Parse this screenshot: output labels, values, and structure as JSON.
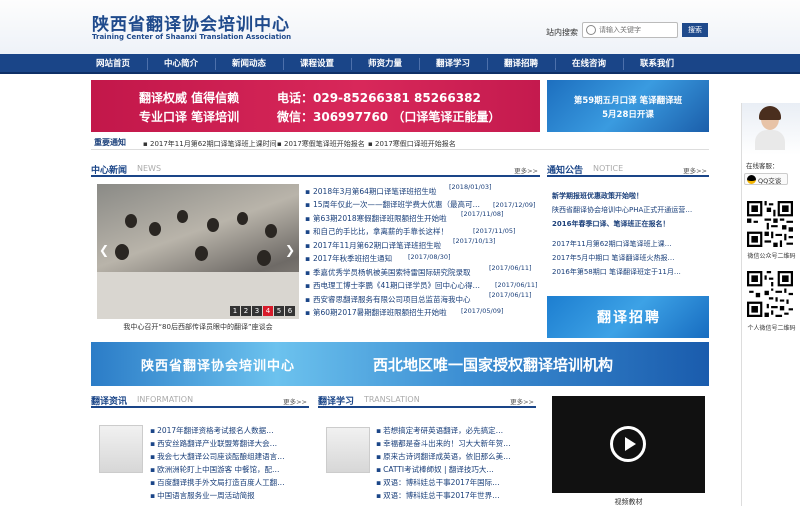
{
  "header": {
    "logo_cn": "陕西省翻译协会培训中心",
    "logo_en": "Training Center of  Shaanxi Translation Association",
    "search_label": "站内搜索",
    "search_placeholder": "请输入关键字",
    "search_button": "搜索"
  },
  "nav": [
    "网站首页",
    "中心简介",
    "新闻动态",
    "课程设置",
    "师资力量",
    "翻译学习",
    "翻译招聘",
    "在线咨询",
    "联系我们"
  ],
  "banner_main": {
    "line1": "翻译权威  值得信赖",
    "line2": "专业口译  笔译培训",
    "phone": "电话：029-85266381 85266382",
    "wechat": "微信：306997760 （口译笔译正能量）"
  },
  "banner_side": {
    "line1": "第59期五月口译 笔译翻译班",
    "line2": "5月28日开课"
  },
  "important_notice": {
    "label": "重要通知",
    "items": [
      "2017年11月第62期口译笔译班上课时间",
      "2017寒假笔译班开始报名",
      "2017寒假口译班开始报名"
    ]
  },
  "center_news": {
    "title_cn": "中心新闻",
    "title_en": "NEWS",
    "more": "更多>>",
    "caption": "我中心召开“80后西部传译员眼中的翻译”座谈会",
    "slides": [
      "1",
      "2",
      "3",
      "4",
      "5",
      "6"
    ],
    "active_slide": 4,
    "items": [
      {
        "text": "2018年3月第64期口译笔译班招生啦",
        "date": "[2018/01/03]"
      },
      {
        "text": "15周年仅此一次——翻译班学费大优惠（最高可…",
        "date": "[2017/12/09]"
      },
      {
        "text": "第63期2018寒假翻译班限额招生开始啦",
        "date": "[2017/11/08]"
      },
      {
        "text": "和自己的手比比，拿离薪的手靠长这样！",
        "date": "[2017/11/05]"
      },
      {
        "text": "2017年11月第62期口译笔译班招生啦",
        "date": "[2017/10/13]"
      },
      {
        "text": "2017年秋季班招生通知",
        "date": "[2017/08/30]"
      },
      {
        "text": "季嘉优秀学员杨帆被美国索特雷国际研究院录取",
        "date": "[2017/06/11]"
      },
      {
        "text": "西电理工博士李鹏《41期口译学员》回中心心得…",
        "date": "[2017/06/11]"
      },
      {
        "text": "西安睿思翻译服务有限公司项目总监苗海我中心",
        "date": "[2017/06/11]"
      },
      {
        "text": "第60期2017暑期翻译班限额招生开始啦",
        "date": "[2017/05/09]"
      }
    ]
  },
  "announcements": {
    "title_cn": "通知公告",
    "title_en": "NOTICE",
    "more": "更多>>",
    "items": [
      {
        "text": "新学期报班优惠政策开始啦！",
        "highlight": true
      },
      {
        "text": "陕西省翻译协会培训中心PHA正式开通运营…",
        "highlight": false
      },
      {
        "text": "2016年春季口译、笔译班正在报名！",
        "highlight": true
      },
      {
        "text": "2017年11月第62期口译笔译班上课…",
        "highlight": false
      },
      {
        "text": "2017年5月中期口 笔译翻译班火热报…",
        "highlight": false
      },
      {
        "text": "2016年第58期口 笔译翻译班定于11月…",
        "highlight": false
      }
    ]
  },
  "recruit_banner": "翻译招聘",
  "wide_banner": {
    "left": "陕西省翻译协会培训中心",
    "right": "西北地区唯一国家授权翻译培训机构"
  },
  "translation_info": {
    "title_cn": "翻译资讯",
    "title_en": "INFORMATION",
    "more": "更多>>",
    "items": [
      "2017年翻译资格考试报名人数据…",
      "西安丝路翻译产业联盟筹翻译大会…",
      "我会七大翻译公司座谈酝酿组建语言…",
      "欧洲洲轮盯上中国游客 中餐馆，配…",
      "百度翻译携手外文局打造百度人工翻…",
      "中国语言服务业一周活动简报"
    ]
  },
  "translation_study": {
    "title_cn": "翻译学习",
    "title_en": "TRANSLATION",
    "more": "更多>>",
    "items": [
      "若想搞定考研英语翻译，必先搞定…",
      "幸福都是奋斗出来的！习大大新年贺…",
      "原来古诗词翻译成英语，依旧那么美…",
      "CATTI考试棒師奴 | 翻译技巧大…",
      "双语：博科娃总干事2017年国际…",
      "双语：博科娃总干事2017年世界…"
    ]
  },
  "video": {
    "caption": "视频教材"
  },
  "service_panel": {
    "online_label": "在线客服：",
    "qq_label": "QQ交谈",
    "qr1_caption": "微信公众号二维码",
    "qr2_caption": "个人微信号二维码"
  },
  "colors": {
    "nav": "#1a4588",
    "banner_red": "#c2174a",
    "link": "#1a3f7a"
  }
}
